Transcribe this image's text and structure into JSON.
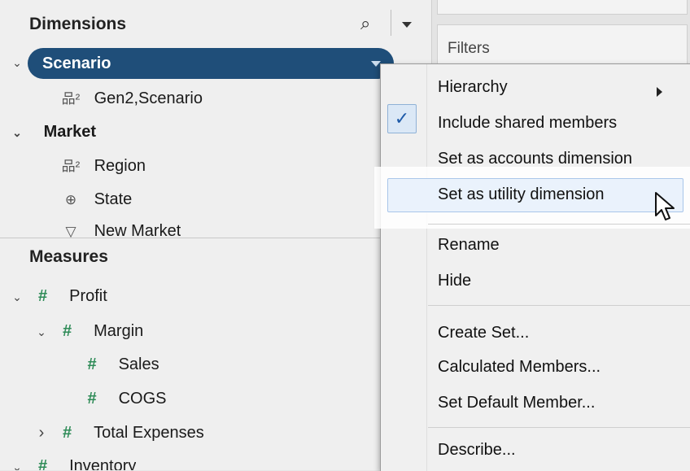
{
  "dimensions": {
    "title": "Dimensions",
    "scenario": {
      "label": "Scenario",
      "child": "Gen2,Scenario"
    },
    "market": {
      "label": "Market",
      "children": [
        "Region",
        "State",
        "New Market"
      ]
    }
  },
  "measures": {
    "title": "Measures",
    "items": [
      {
        "label": "Profit",
        "chevron": "⌄"
      },
      {
        "label": "Margin",
        "chevron": "⌄"
      },
      {
        "label": "Sales",
        "chevron": ""
      },
      {
        "label": "COGS",
        "chevron": ""
      },
      {
        "label": "Total Expenses",
        "chevron": "›"
      },
      {
        "label": "Inventory",
        "chevron": "⌄"
      }
    ]
  },
  "shelf": {
    "filters_label": "Filters"
  },
  "menu": {
    "items": [
      "Hierarchy",
      "Include shared members",
      "Set as accounts dimension",
      "Set as utility dimension",
      "Rename",
      "Hide",
      "Create Set...",
      "Calculated Members...",
      "Set Default Member...",
      "Describe..."
    ],
    "check_glyph": "✓"
  },
  "icons": {
    "search": "⌕",
    "hierarchy": "品²",
    "globe": "⊕",
    "triangle": "▽",
    "hash": "#"
  },
  "colors": {
    "selected_pill": "#1f4e79",
    "measure_hash": "#2e8b57"
  }
}
